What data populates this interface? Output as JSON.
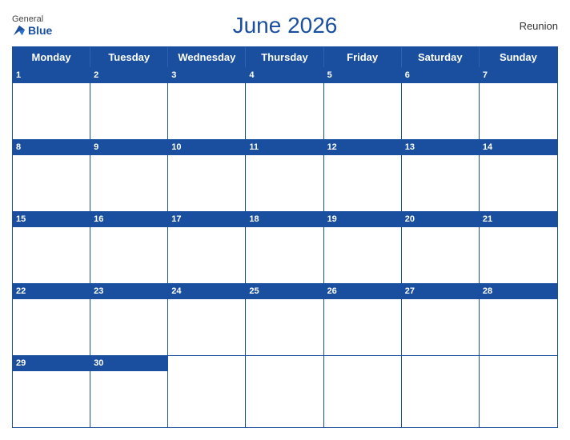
{
  "header": {
    "title": "June 2026",
    "region": "Reunion",
    "logo_general": "General",
    "logo_blue": "Blue"
  },
  "calendar": {
    "days_of_week": [
      "Monday",
      "Tuesday",
      "Wednesday",
      "Thursday",
      "Friday",
      "Saturday",
      "Sunday"
    ],
    "weeks": [
      [
        {
          "num": "1",
          "empty": false
        },
        {
          "num": "2",
          "empty": false
        },
        {
          "num": "3",
          "empty": false
        },
        {
          "num": "4",
          "empty": false
        },
        {
          "num": "5",
          "empty": false
        },
        {
          "num": "6",
          "empty": false
        },
        {
          "num": "7",
          "empty": false
        }
      ],
      [
        {
          "num": "8",
          "empty": false
        },
        {
          "num": "9",
          "empty": false
        },
        {
          "num": "10",
          "empty": false
        },
        {
          "num": "11",
          "empty": false
        },
        {
          "num": "12",
          "empty": false
        },
        {
          "num": "13",
          "empty": false
        },
        {
          "num": "14",
          "empty": false
        }
      ],
      [
        {
          "num": "15",
          "empty": false
        },
        {
          "num": "16",
          "empty": false
        },
        {
          "num": "17",
          "empty": false
        },
        {
          "num": "18",
          "empty": false
        },
        {
          "num": "19",
          "empty": false
        },
        {
          "num": "20",
          "empty": false
        },
        {
          "num": "21",
          "empty": false
        }
      ],
      [
        {
          "num": "22",
          "empty": false
        },
        {
          "num": "23",
          "empty": false
        },
        {
          "num": "24",
          "empty": false
        },
        {
          "num": "25",
          "empty": false
        },
        {
          "num": "26",
          "empty": false
        },
        {
          "num": "27",
          "empty": false
        },
        {
          "num": "28",
          "empty": false
        }
      ],
      [
        {
          "num": "29",
          "empty": false
        },
        {
          "num": "30",
          "empty": false
        },
        {
          "num": "",
          "empty": true
        },
        {
          "num": "",
          "empty": true
        },
        {
          "num": "",
          "empty": true
        },
        {
          "num": "",
          "empty": true
        },
        {
          "num": "",
          "empty": true
        }
      ]
    ]
  }
}
